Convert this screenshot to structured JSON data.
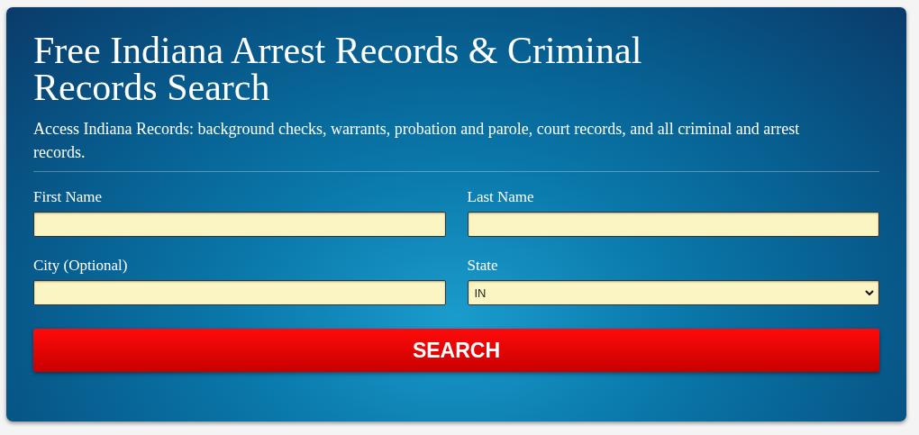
{
  "title": "Free Indiana Arrest Records & Criminal Records Search",
  "description": "Access Indiana Records: background checks, warrants, probation and parole, court records, and all criminal and arrest records.",
  "fields": [
    {
      "kind": "text",
      "label": "First Name"
    },
    {
      "kind": "text",
      "label": "Last Name"
    },
    {
      "kind": "text",
      "label": "City (Optional)"
    },
    {
      "kind": "select",
      "label": "State",
      "value": "IN"
    }
  ],
  "button": "SEARCH"
}
